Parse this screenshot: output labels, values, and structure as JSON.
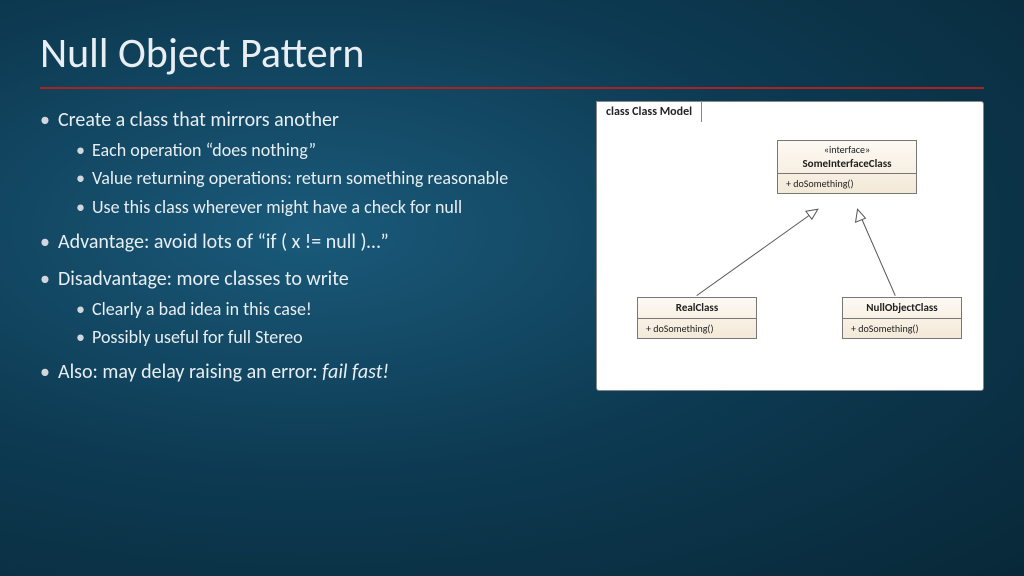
{
  "title": "Null Object Pattern",
  "bullets": {
    "b1": "Create a class that mirrors another",
    "b1a": "Each operation “does nothing”",
    "b1b": "Value returning operations: return something reasonable",
    "b1c": "Use this class wherever might have a check for null",
    "b2": "Advantage: avoid lots of “if ( x != null )…”",
    "b3": "Disadvantage: more classes to write",
    "b3a": "Clearly a bad idea in this case!",
    "b3b": "Possibly useful for full Stereo",
    "b4_prefix": "Also: may delay raising an error: ",
    "b4_em": "fail fast!"
  },
  "uml": {
    "frame_label": "class Class Model",
    "interface_stereo": "«interface»",
    "interface_name": "SomeInterfaceClass",
    "interface_op": "+   doSomething()",
    "real_name": "RealClass",
    "real_op": "+   doSomething()",
    "null_name": "NullObjectClass",
    "null_op": "+   doSomething()"
  }
}
